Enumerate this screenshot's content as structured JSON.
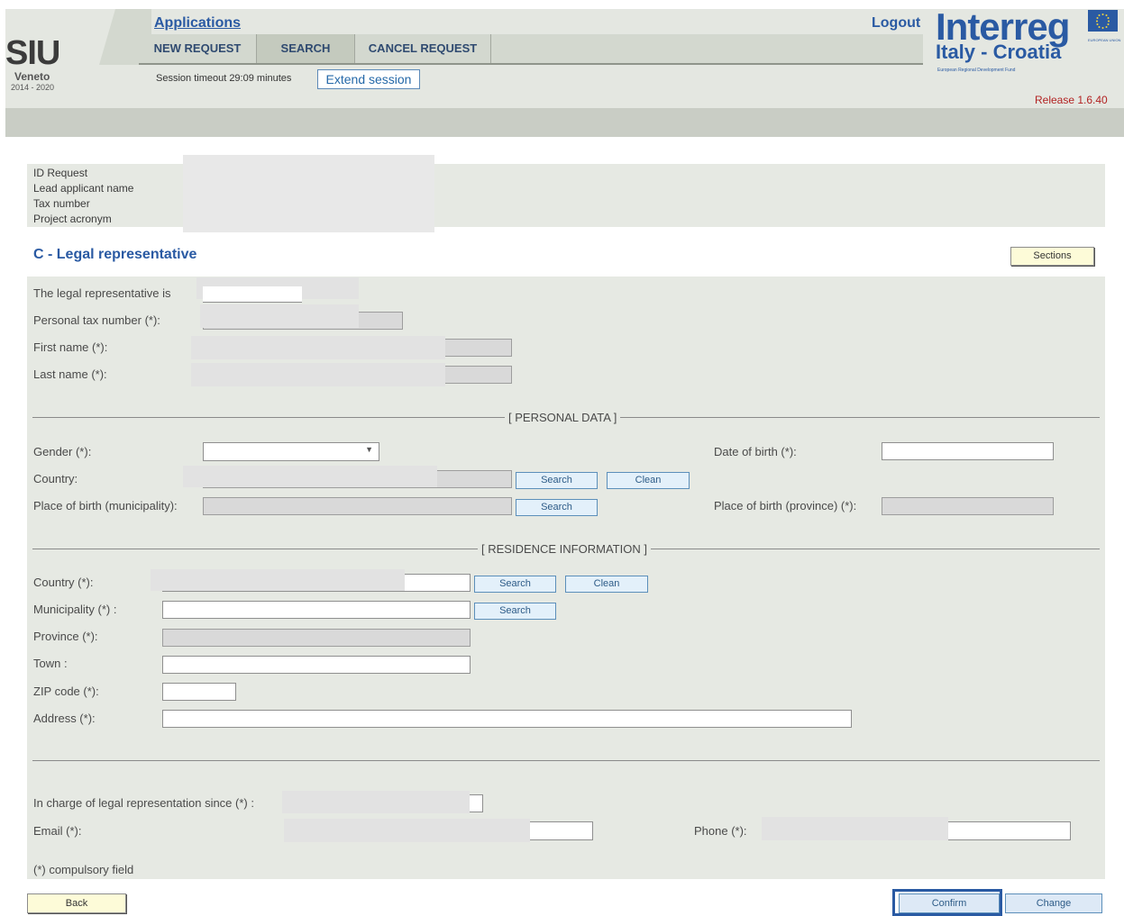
{
  "header": {
    "logo_text": "SIU",
    "logo_region": "Veneto",
    "logo_years": "2014 - 2020",
    "applications_link": "Applications",
    "menu": [
      "NEW REQUEST",
      "SEARCH",
      "CANCEL REQUEST"
    ],
    "session_text": "Session timeout 29:09 minutes",
    "extend_label": "Extend session",
    "logout_label": "Logout",
    "program_title": "Interreg",
    "program_subtitle": "Italy - Croatia",
    "fund_text": "European Regional Development Fund",
    "eu_caption": "EUROPEAN UNION",
    "release": "Release 1.6.40"
  },
  "info": {
    "labels": [
      "ID Request",
      "Lead applicant name",
      "Tax number",
      "Project acronym"
    ]
  },
  "section": {
    "title": "C - Legal representative",
    "sections_button": "Sections"
  },
  "form": {
    "legal_rep_label": "The legal representative is",
    "tax_number_label": "Personal tax number (*):",
    "first_name_label": "First name (*):",
    "last_name_label": "Last name (*):",
    "personal_data_divider": "[ PERSONAL DATA ]",
    "gender_label": "Gender (*):",
    "gender_value": "",
    "birth_date_label": "Date of birth (*):",
    "country_label": "Country:",
    "place_birth_label": "Place of birth (municipality):",
    "place_birth_province_label": "Place of birth (province) (*):",
    "residence_divider": "[ RESIDENCE INFORMATION ]",
    "res_country_label": "Country (*):",
    "municipality_label": "Municipality (*) :",
    "province_label": "Province (*):",
    "town_label": "Town :",
    "zip_label": "ZIP code (*):",
    "address_label": "Address (*):",
    "since_label": "In charge of legal representation since (*) :",
    "email_label": "Email (*):",
    "phone_label": "Phone (*):",
    "compulsory_note": "(*) compulsory field",
    "search_label": "Search",
    "clean_label": "Clean"
  },
  "footer": {
    "back_label": "Back",
    "confirm_label": "Confirm",
    "change_label": "Change"
  },
  "colors": {
    "accent": "#2a5aa3",
    "header_bg": "#e4e7e1",
    "form_bg": "#e6e9e3",
    "release_red": "#b22222"
  }
}
